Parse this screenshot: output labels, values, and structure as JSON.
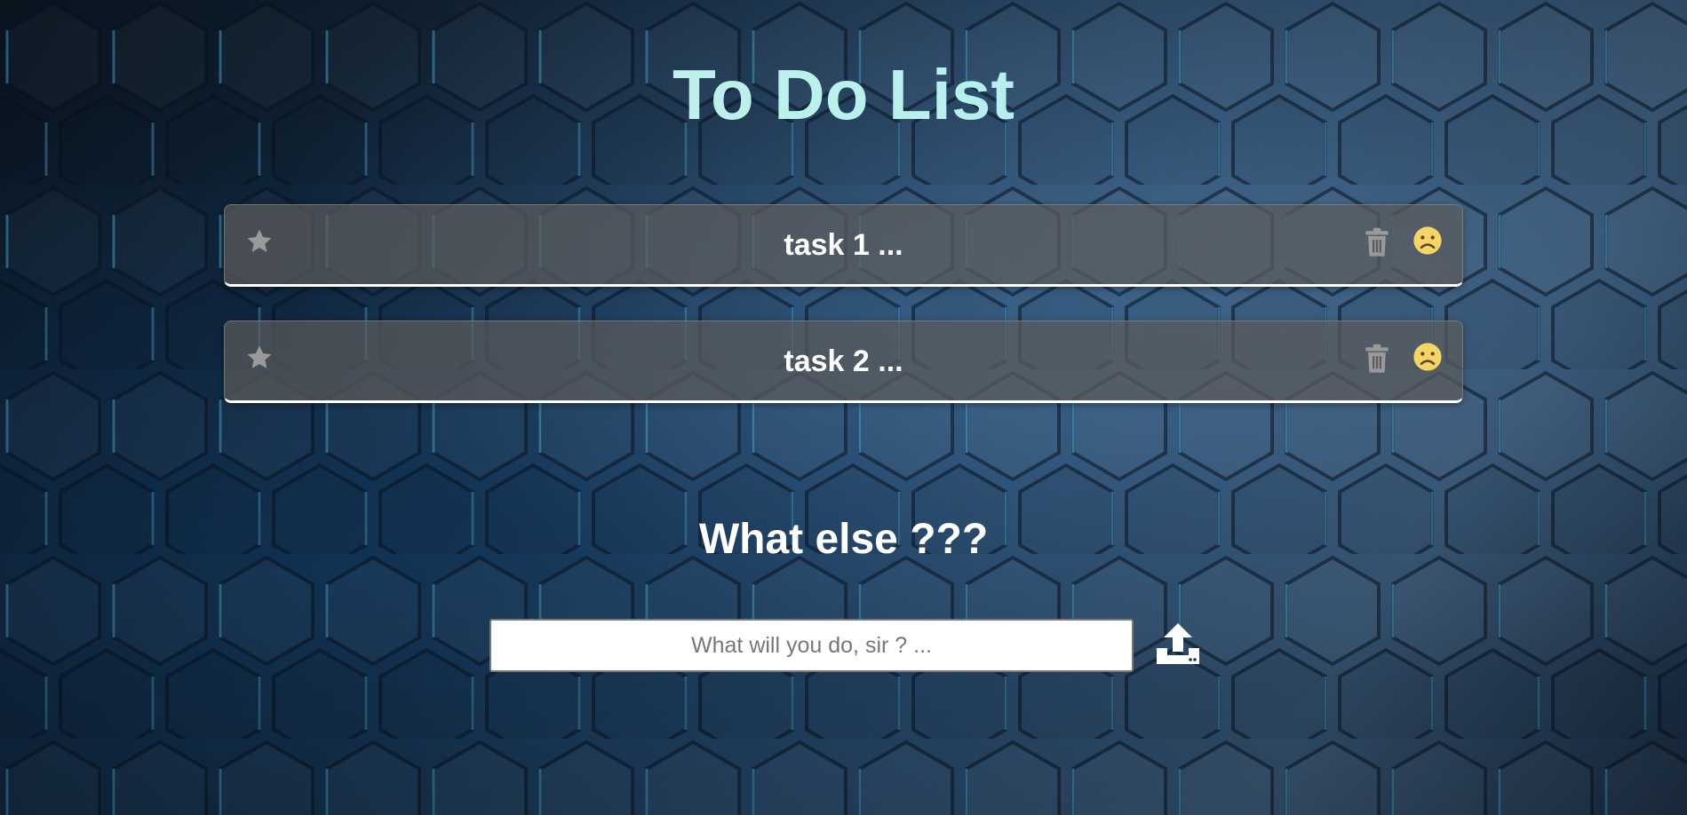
{
  "page": {
    "title": "To Do List",
    "subtitle": "What else ???"
  },
  "tasks": [
    {
      "label": "task 1 ...",
      "star_icon": "star-icon",
      "delete_icon": "trash-icon",
      "status_icon": "frown-face-icon"
    },
    {
      "label": "task 2 ...",
      "star_icon": "star-icon",
      "delete_icon": "trash-icon",
      "status_icon": "frown-face-icon"
    }
  ],
  "new_task": {
    "placeholder": "What will you do, sir ? ...",
    "value": "",
    "submit_icon": "upload-icon"
  },
  "colors": {
    "title_gradient_start": "#d9ece4",
    "title_gradient_end": "#a7e7f4",
    "task_card_bg": "#5c5c5c",
    "status_face": "#f5d565",
    "muted_icon": "#9a9a9a",
    "text_white": "#ffffff"
  }
}
